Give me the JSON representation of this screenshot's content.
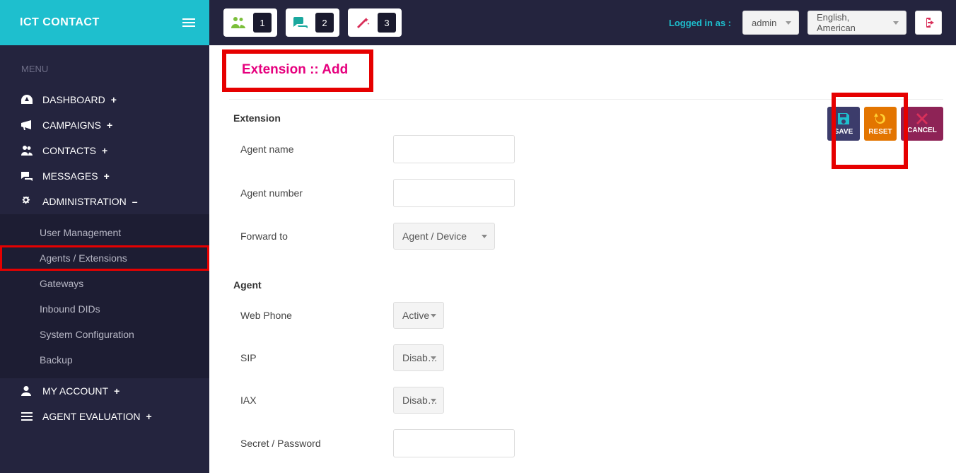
{
  "brand": "ICT CONTACT",
  "menu_label": "MENU",
  "menu": {
    "dashboard": "DASHBOARD",
    "campaigns": "CAMPAIGNS",
    "contacts": "CONTACTS",
    "messages": "MESSAGES",
    "administration": "ADMINISTRATION",
    "my_account": "MY ACCOUNT",
    "agent_evaluation": "AGENT EVALUATION"
  },
  "admin_sub": {
    "user_management": "User Management",
    "agents_extensions": "Agents / Extensions",
    "gateways": "Gateways",
    "inbound_dids": "Inbound DIDs",
    "system_configuration": "System Configuration",
    "backup": "Backup"
  },
  "topbar": {
    "stat1": "1",
    "stat2": "2",
    "stat3": "3",
    "logged_in_label": "Logged in as :",
    "user": "admin",
    "language": "English, American"
  },
  "page_title": "Extension :: Add",
  "buttons": {
    "save": "SAVE",
    "reset": "RESET",
    "cancel": "CANCEL"
  },
  "sections": {
    "extension": "Extension",
    "agent": "Agent"
  },
  "fields": {
    "agent_name": "Agent name",
    "agent_number": "Agent number",
    "forward_to": "Forward to",
    "web_phone": "Web Phone",
    "sip": "SIP",
    "iax": "IAX",
    "secret": "Secret / Password"
  },
  "values": {
    "forward_to": "Agent / Device",
    "web_phone": "Active",
    "sip": "Disab…",
    "iax": "Disab…"
  },
  "toggles": {
    "plus": "+",
    "minus": "–"
  }
}
